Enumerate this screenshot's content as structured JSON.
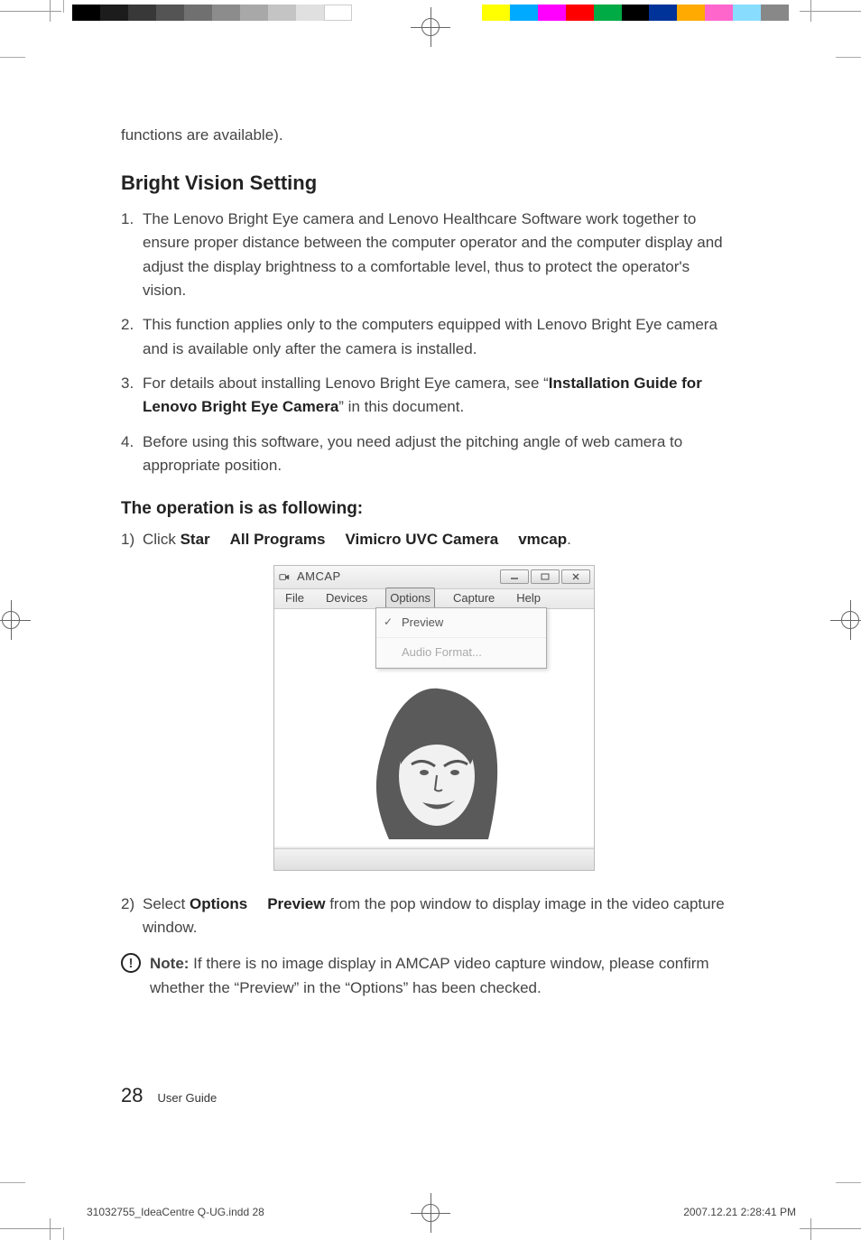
{
  "fragment_text": "functions are available).",
  "heading": "Bright Vision Setting",
  "list": [
    {
      "pre": "The Lenovo Bright Eye camera and Lenovo Healthcare Software work together to ensure proper distance between the computer operator and the computer display and adjust the display brightness to a comfortable level, thus to protect the operator's vision.",
      "bold": "",
      "post": ""
    },
    {
      "pre": "This function applies only to the computers equipped with Lenovo Bright Eye camera and is available only after the camera is installed.",
      "bold": "",
      "post": ""
    },
    {
      "pre": "For details about installing Lenovo Bright Eye camera, see “",
      "bold": "Installation Guide for Lenovo Bright Eye Camera",
      "post": "” in this document."
    },
    {
      "pre": "Before using this software, you need adjust the pitching angle of web camera to appropriate position.",
      "bold": "",
      "post": ""
    }
  ],
  "subheading": "The operation is as following:",
  "step1": {
    "lead": "Click ",
    "p1": "Star",
    "p2": "All Programs",
    "p3": "Vimicro UVC Camera",
    "p4": "vmcap",
    "tail": "."
  },
  "step2": {
    "lead": "Select ",
    "p1": "Options",
    "p2": "Preview",
    "tail": " from the pop window to display image in the video capture window."
  },
  "note": {
    "label": "Note:",
    "text": " If there is no image display in AMCAP video capture window, please confirm whether the “Preview” in the “Options” has been checked."
  },
  "screenshot": {
    "title": "AMCAP",
    "menus": [
      "File",
      "Devices",
      "Options",
      "Capture",
      "Help"
    ],
    "dropdown": [
      {
        "label": "Preview",
        "checked": true
      },
      {
        "label": "Audio Format...",
        "checked": false
      }
    ],
    "win_controls": {
      "min": "min",
      "max": "max",
      "close": "close"
    }
  },
  "footer": {
    "page": "28",
    "label": "User Guide"
  },
  "slug": {
    "file": "31032755_IdeaCentre Q-UG.indd   28",
    "date": "2007.12.21   2:28:41 PM"
  },
  "colors": {
    "gray_bar": [
      "#000",
      "#1c1c1c",
      "#383838",
      "#545454",
      "#707070",
      "#8c8c8c",
      "#a8a8a8",
      "#c4c4c4",
      "#e0e0e0",
      "#fff"
    ],
    "color_bar": [
      "#ffff00",
      "#00aaff",
      "#ff00ff",
      "#ff0000",
      "#00aa44",
      "#000000",
      "#003399",
      "#ffaa00",
      "#ff66cc",
      "#88ddff",
      "#888888"
    ]
  }
}
